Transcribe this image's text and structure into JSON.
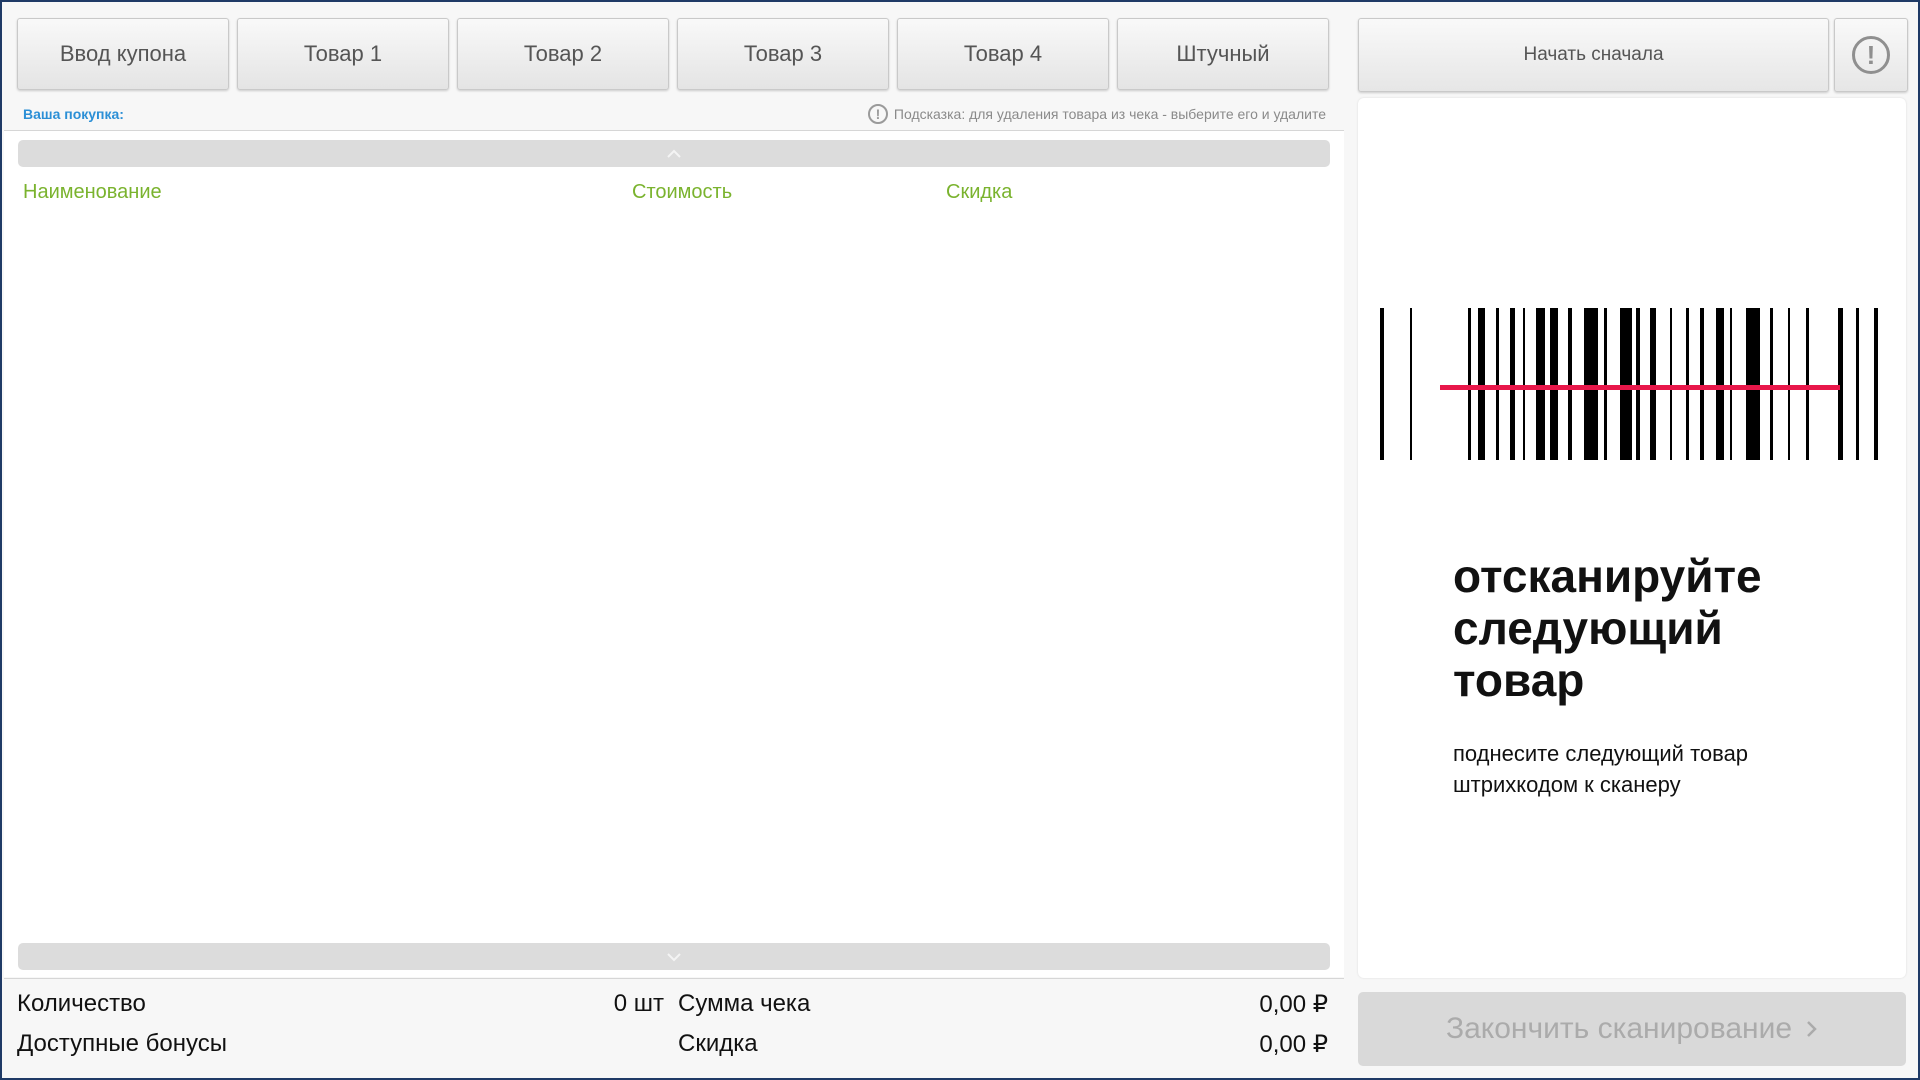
{
  "top_buttons": [
    {
      "label": "Ввод купона"
    },
    {
      "label": "Товар 1"
    },
    {
      "label": "Товар 2"
    },
    {
      "label": "Товар 3"
    },
    {
      "label": "Товар 4"
    },
    {
      "label": "Штучный"
    }
  ],
  "receipt": {
    "purchase_label": "Ваша покупка:",
    "hint_icon": "exclamation-circle-icon",
    "hint_text": "Подсказка: для удаления товара из чека - выберите его и удалите",
    "columns": [
      "Наименование",
      "Стоимость",
      "Скидка"
    ],
    "scroll_up_icon": "chevron-up-icon",
    "scroll_down_icon": "chevron-down-icon"
  },
  "totals": {
    "quantity_label": "Количество",
    "quantity_value": "0 шт",
    "bonuses_label": "Доступные бонусы",
    "sum_label": "Сумма чека",
    "sum_value": "0,00 ₽",
    "discount_label": "Скидка",
    "discount_value": "0,00 ₽"
  },
  "right_panel": {
    "restart_label": "Начать сначала",
    "alert_icon": "exclamation-circle-icon",
    "barcode_icon": "barcode-scan-icon",
    "scan_title": "отсканируйте\nследующий\nтовар",
    "scan_subtitle": "поднесите следующий товар\nштрихкодом к сканеру",
    "finish_label": "Закончить сканирование",
    "finish_icon": "chevron-right-icon"
  },
  "colors": {
    "accent_blue": "#2b8fd6",
    "column_green": "#7ab32e",
    "scan_line_red": "#e8174a",
    "frame_border": "#1f3a66"
  }
}
